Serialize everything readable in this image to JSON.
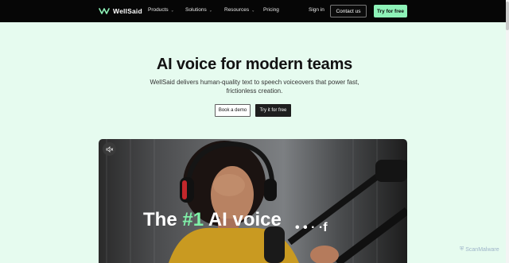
{
  "brand": {
    "name": "WellSaid"
  },
  "nav": {
    "items": [
      {
        "label": "Products",
        "has_caret": true
      },
      {
        "label": "Solutions",
        "has_caret": true
      },
      {
        "label": "Resources",
        "has_caret": true
      },
      {
        "label": "Pricing",
        "has_caret": false
      }
    ],
    "signin": "Sign in",
    "contact": "Contact us",
    "try_free": "Try for free"
  },
  "hero": {
    "title": "AI voice for modern teams",
    "subtitle": "WellSaid delivers human-quality text to speech voiceovers that power fast, frictionless creation.",
    "demo_button": "Book a demo",
    "try_button": "Try it for free"
  },
  "video": {
    "headline_prefix": "The ",
    "headline_number": "#1",
    "headline_suffix": " AI voice",
    "trailing_text": "• • · ·f",
    "mute_icon": "speaker-muted-icon"
  },
  "watermark": {
    "text": "ScanMalware"
  },
  "colors": {
    "accent": "#8ef2b8",
    "hero_bg": "#e6fbef",
    "nav_bg": "#060606"
  }
}
